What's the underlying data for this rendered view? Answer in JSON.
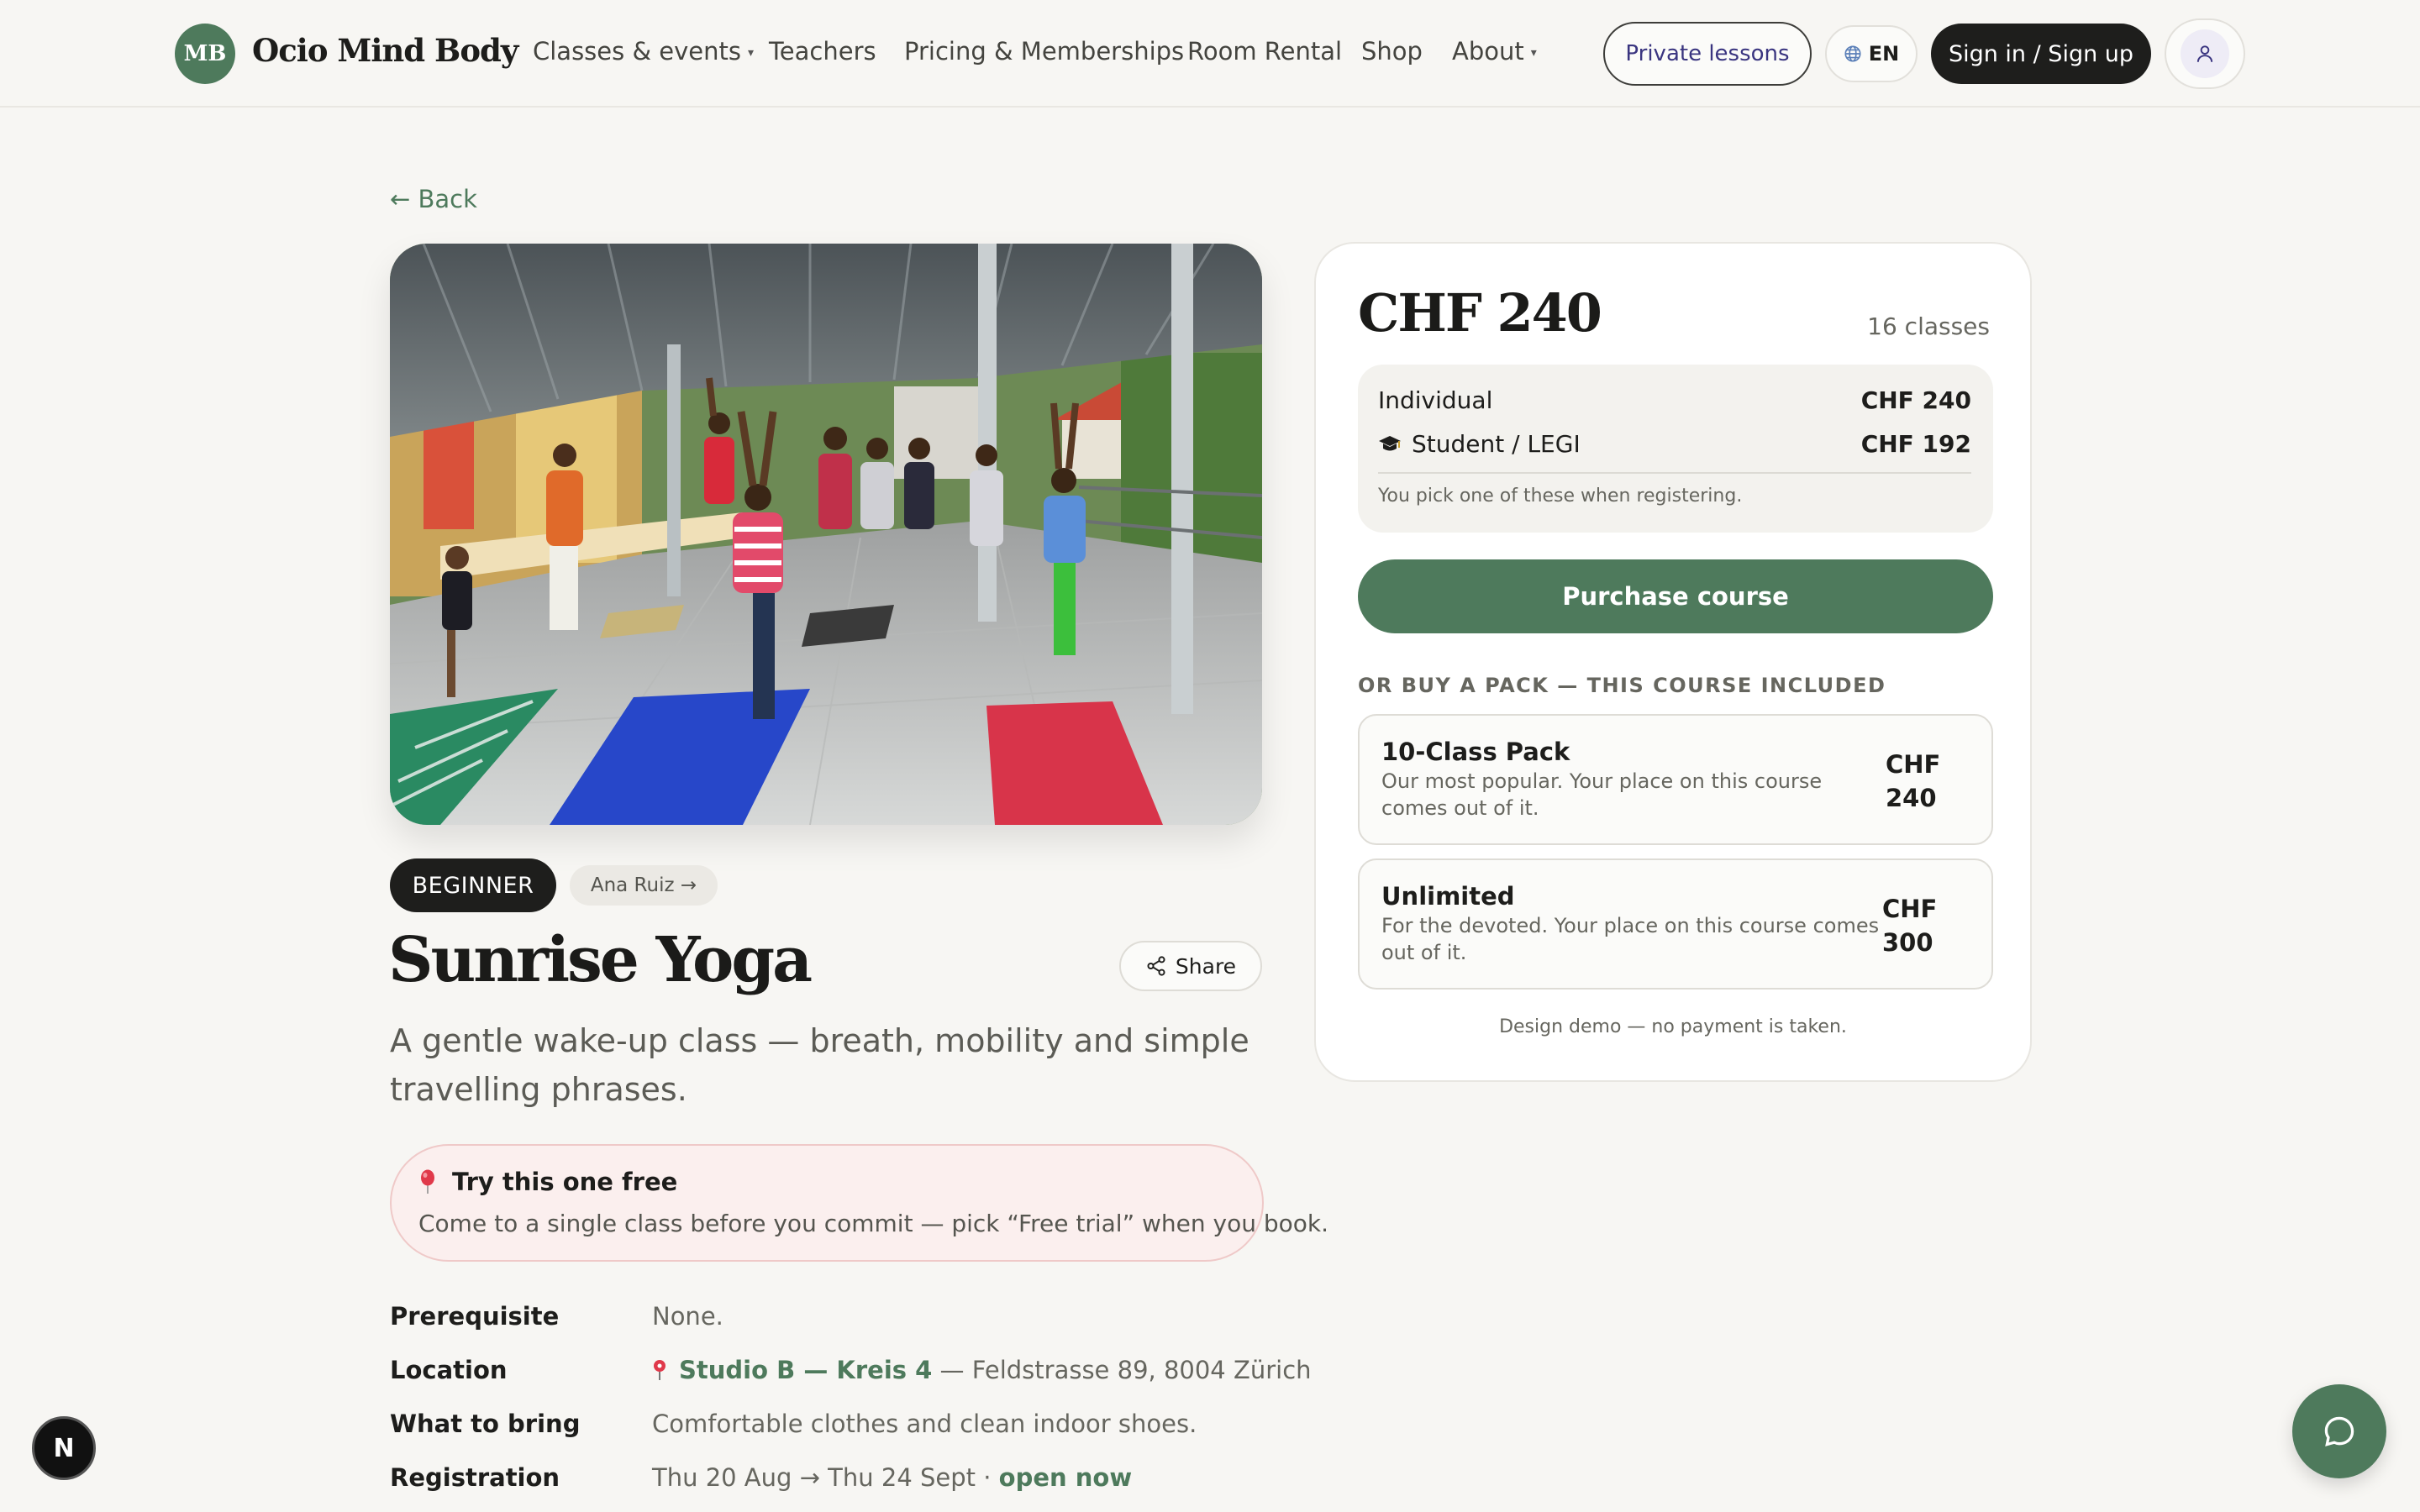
{
  "brand": {
    "mark": "MB",
    "name": "Ocio Mind Body"
  },
  "nav": {
    "items": [
      {
        "label": "Classes & events",
        "has_dropdown": true
      },
      {
        "label": "Teachers",
        "has_dropdown": false
      },
      {
        "label": "Pricing & Memberships",
        "has_dropdown": false
      },
      {
        "label": "Room Rental",
        "has_dropdown": false
      },
      {
        "label": "Shop",
        "has_dropdown": false
      },
      {
        "label": "About",
        "has_dropdown": true
      }
    ],
    "dropdown_glyph": "▾"
  },
  "header_actions": {
    "private_lessons": "Private lessons",
    "language": "EN",
    "sign_in": "Sign in / Sign up",
    "user_icon": "user-icon",
    "globe_icon": "globe-icon"
  },
  "back": {
    "label": "← Back"
  },
  "course": {
    "level_tag": "BEGINNER",
    "teacher_tag": "Ana Ruiz →",
    "title": "Sunrise Yoga",
    "share_label": "Share",
    "description": "A gentle wake-up class — breath, mobility and simple travelling phrases."
  },
  "trial": {
    "title": "Try this one free",
    "text": "Come to a single class before you commit — pick “Free trial” when you book.",
    "icon": "balloon-icon"
  },
  "details": [
    {
      "label": "Prerequisite",
      "value": "None."
    },
    {
      "label": "Location",
      "link": "Studio B — Kreis 4",
      "value": " — Feldstrasse 89, 8004 Zürich"
    },
    {
      "label": "What to bring",
      "value": "Comfortable clothes and clean indoor shoes."
    },
    {
      "label": "Registration",
      "value": "Thu 20 Aug → Thu 24 Sept · ",
      "status": "open now"
    }
  ],
  "pricing": {
    "price": "CHF 240",
    "class_count": "16 classes",
    "tiers": [
      {
        "label": "Individual",
        "price": "CHF 240"
      },
      {
        "label": "Student / LEGI",
        "price": "CHF 192",
        "icon": "graduation-cap-icon"
      }
    ],
    "tier_note": "You pick one of these when registering.",
    "purchase_label": "Purchase course",
    "pack_heading": "OR BUY A PACK — THIS COURSE INCLUDED",
    "packs": [
      {
        "name": "10-Class Pack",
        "desc": "Our most popular. Your place on this course comes out of it.",
        "price_currency": "CHF",
        "price_amount": "240"
      },
      {
        "name": "Unlimited",
        "desc": "For the devoted. Your place on this course comes out of it.",
        "price_currency": "CHF",
        "price_amount": "300"
      }
    ],
    "demo_note": "Design demo — no payment is taken."
  },
  "floating": {
    "n_badge": "N",
    "chat_icon": "chat-bubble-icon"
  },
  "colors": {
    "accent": "#4e7a5c",
    "dark": "#1e1e1c",
    "background": "#f7f6f3",
    "trial_bg": "#fbefee"
  }
}
